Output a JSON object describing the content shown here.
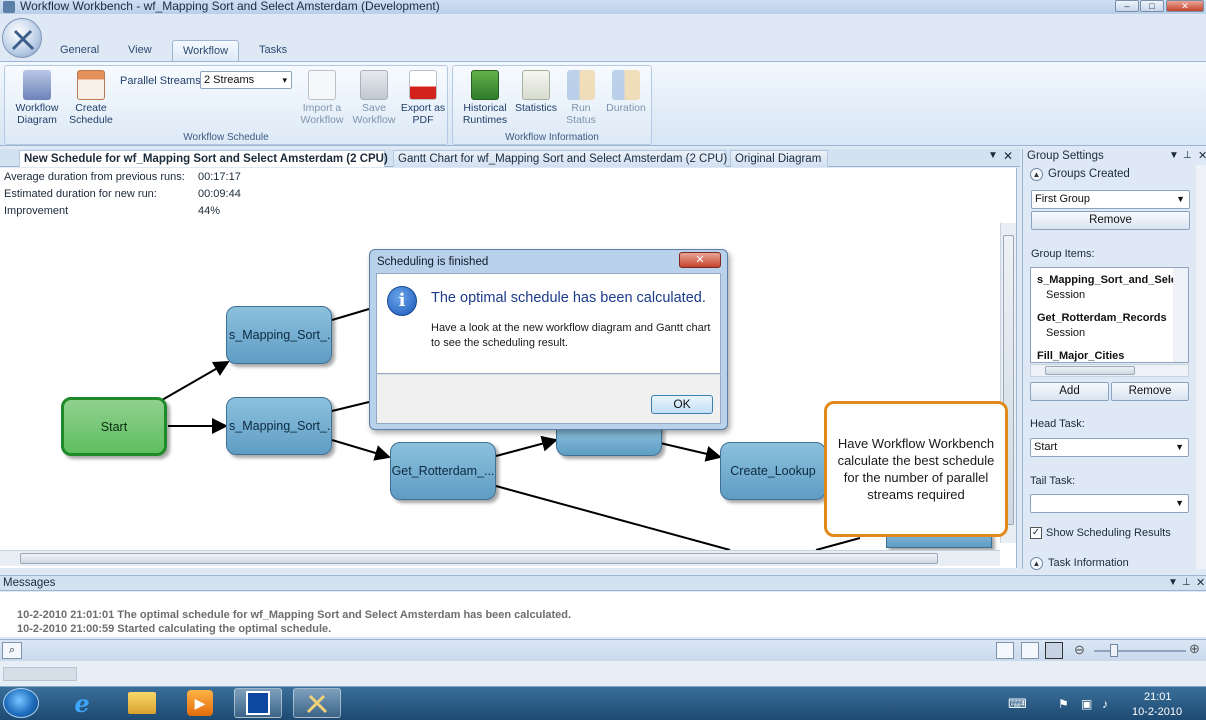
{
  "window": {
    "title": "Workflow Workbench - wf_Mapping Sort and Select Amsterdam (Development)",
    "min": "–",
    "max": "□",
    "close": "✕"
  },
  "ribbon": {
    "tabs": [
      "General",
      "View",
      "Workflow",
      "Tasks"
    ],
    "active_tab": "Workflow",
    "parallel_streams_label": "Parallel Streams:",
    "parallel_streams_value": "2 Streams",
    "groups": {
      "schedule": {
        "label": "Workflow Schedule",
        "workflow_diagram": "Workflow Diagram",
        "create_schedule": "Create Schedule",
        "import_workflow": "Import a Workflow",
        "save_workflow": "Save Workflow",
        "export_pdf": "Export as PDF"
      },
      "information": {
        "label": "Workflow Information",
        "historical_runtimes": "Historical Runtimes",
        "statistics": "Statistics",
        "run_status": "Run Status",
        "duration": "Duration"
      }
    }
  },
  "doc_tabs": [
    "New Schedule for wf_Mapping Sort and Select Amsterdam (2 CPU)",
    "Gantt Chart for wf_Mapping Sort and Select Amsterdam (2 CPU)",
    "Original Diagram"
  ],
  "stats": [
    {
      "label": "Average duration from previous runs:",
      "value": "00:17:17"
    },
    {
      "label": "Estimated duration for new run:",
      "value": "00:09:44"
    },
    {
      "label": "Improvement",
      "value": "44%"
    }
  ],
  "nodes": {
    "start": "Start",
    "mapping1": "s_Mapping_Sort_...",
    "mapping2": "s_Mapping_Sort_...",
    "rotterdam": "Get_Rotterdam_...",
    "create_lookup": "Create_Lookup"
  },
  "callout": "Have Workflow Workbench calculate the best schedule for the number of parallel streams required",
  "dialog": {
    "title": "Scheduling is finished",
    "heading": "The optimal schedule has been calculated.",
    "message": "Have a look at the new workflow diagram and Gantt chart to see the scheduling result.",
    "ok": "OK"
  },
  "group_settings": {
    "title": "Group Settings",
    "groups_created": "Groups Created",
    "group_select": "First Group",
    "remove": "Remove",
    "group_items_label": "Group Items:",
    "items": [
      {
        "name": "s_Mapping_Sort_and_Sele",
        "type": "Session"
      },
      {
        "name": "Get_Rotterdam_Records",
        "type": "Session"
      },
      {
        "name": "Fill_Major_Cities",
        "type": ""
      }
    ],
    "add": "Add",
    "remove2": "Remove",
    "head_task_label": "Head Task:",
    "head_task_value": "Start",
    "tail_task_label": "Tail Task:",
    "tail_task_value": "",
    "show_results": "Show Scheduling Results",
    "task_information": "Task Information"
  },
  "messages": {
    "title": "Messages",
    "lines": [
      "10-2-2010 21:01:01 The optimal schedule for wf_Mapping Sort and Select Amsterdam has been calculated.",
      "10-2-2010 21:00:59 Started calculating the optimal schedule."
    ]
  },
  "taskbar": {
    "time": "21:01",
    "date": "10-2-2010"
  }
}
